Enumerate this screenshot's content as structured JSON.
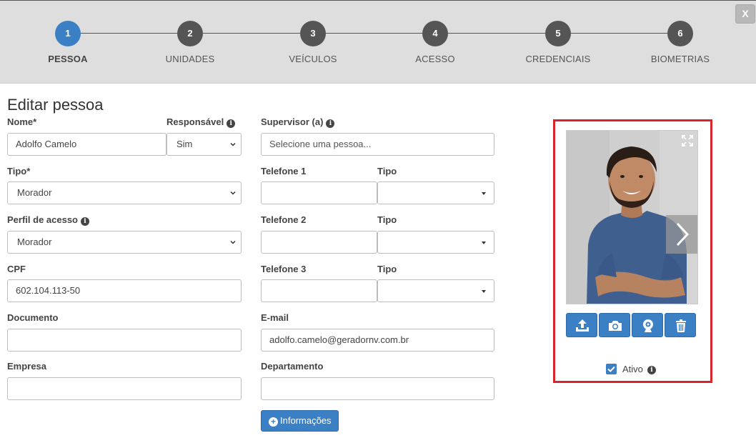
{
  "wizard": {
    "steps": [
      {
        "number": "1",
        "label": "PESSOA",
        "active": true
      },
      {
        "number": "2",
        "label": "UNIDADES",
        "active": false
      },
      {
        "number": "3",
        "label": "VEÍCULOS",
        "active": false
      },
      {
        "number": "4",
        "label": "ACESSO",
        "active": false
      },
      {
        "number": "5",
        "label": "CREDENCIAIS",
        "active": false
      },
      {
        "number": "6",
        "label": "BIOMETRIAS",
        "active": false
      }
    ],
    "close_label": "X"
  },
  "page": {
    "title": "Editar pessoa"
  },
  "form": {
    "nome": {
      "label": "Nome*",
      "value": "Adolfo Camelo"
    },
    "responsavel": {
      "label": "Responsável",
      "value": "Sim"
    },
    "supervisor": {
      "label": "Supervisor (a)",
      "placeholder": "Selecione uma pessoa..."
    },
    "tipo": {
      "label": "Tipo*",
      "value": "Morador"
    },
    "perfil": {
      "label": "Perfil de acesso",
      "value": "Morador"
    },
    "cpf": {
      "label": "CPF",
      "value": "602.104.113-50"
    },
    "documento": {
      "label": "Documento",
      "value": ""
    },
    "empresa": {
      "label": "Empresa",
      "value": ""
    },
    "telefone1": {
      "label": "Telefone 1",
      "value": "",
      "tipo_label": "Tipo",
      "tipo_value": ""
    },
    "telefone2": {
      "label": "Telefone 2",
      "value": "",
      "tipo_label": "Tipo",
      "tipo_value": ""
    },
    "telefone3": {
      "label": "Telefone 3",
      "value": "",
      "tipo_label": "Tipo",
      "tipo_value": ""
    },
    "email": {
      "label": "E-mail",
      "value": "adolfo.camelo@geradornv.com.br"
    },
    "departamento": {
      "label": "Departamento",
      "value": ""
    },
    "info_button": "Informações"
  },
  "photo_panel": {
    "ativo_label": "Ativo",
    "ativo_checked": true,
    "buttons": [
      "upload-icon",
      "camera-icon",
      "webcam-icon",
      "trash-icon"
    ]
  },
  "colors": {
    "primary": "#3b7fc4",
    "highlight_border": "#d9232d",
    "wizard_bg": "#dedede"
  }
}
